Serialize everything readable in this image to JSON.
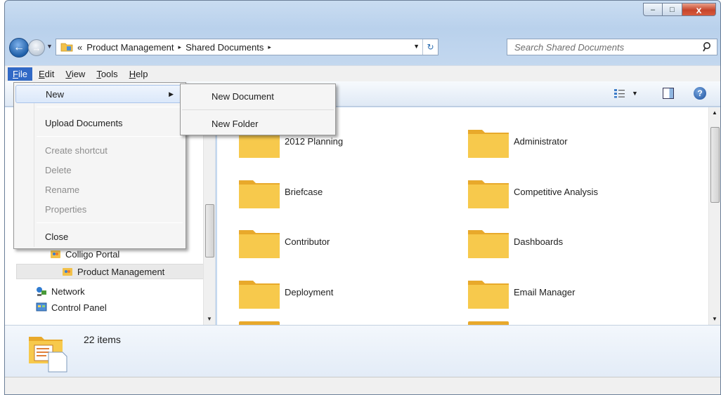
{
  "window": {
    "caption": {
      "minimize": "–",
      "maximize": "□",
      "close": "x"
    }
  },
  "address": {
    "chevron": "«",
    "crumbs": [
      "Product Management",
      "Shared Documents"
    ],
    "separator": "▸"
  },
  "search": {
    "placeholder": "Search Shared Documents"
  },
  "menubar": {
    "items": [
      {
        "accel": "F",
        "rest": "ile"
      },
      {
        "accel": "E",
        "rest": "dit"
      },
      {
        "accel": "V",
        "rest": "iew"
      },
      {
        "accel": "T",
        "rest": "ools"
      },
      {
        "accel": "H",
        "rest": "elp"
      }
    ]
  },
  "file_menu": {
    "items": [
      {
        "label": "New",
        "state": "highlight",
        "submenu": true
      },
      {
        "label": "Upload Documents",
        "state": "enabled"
      },
      {
        "label": "Create shortcut",
        "state": "disabled"
      },
      {
        "label": "Delete",
        "state": "disabled"
      },
      {
        "label": "Rename",
        "state": "disabled"
      },
      {
        "label": "Properties",
        "state": "disabled"
      },
      {
        "label": "Close",
        "state": "enabled"
      }
    ]
  },
  "new_submenu": {
    "items": [
      "New Document",
      "New Folder"
    ]
  },
  "nav_tree": {
    "items": [
      {
        "label": "Colligo Portal",
        "icon": "colligo-portal-icon"
      },
      {
        "label": "Product Management",
        "icon": "colligo-portal-icon",
        "selected": true
      },
      {
        "label": "Network",
        "icon": "network-icon"
      },
      {
        "label": "Control Panel",
        "icon": "control-panel-icon"
      }
    ]
  },
  "folders": {
    "items": [
      "2012 Planning",
      "Administrator",
      "Briefcase",
      "Competitive Analysis",
      "Contributor",
      "Dashboards",
      "Deployment",
      "Email Manager"
    ]
  },
  "details": {
    "item_count": "22 items"
  },
  "colors": {
    "menu_highlight": "#3169c6",
    "folder_yellow": "#f6c23f",
    "frame": "#c4d8ef"
  }
}
